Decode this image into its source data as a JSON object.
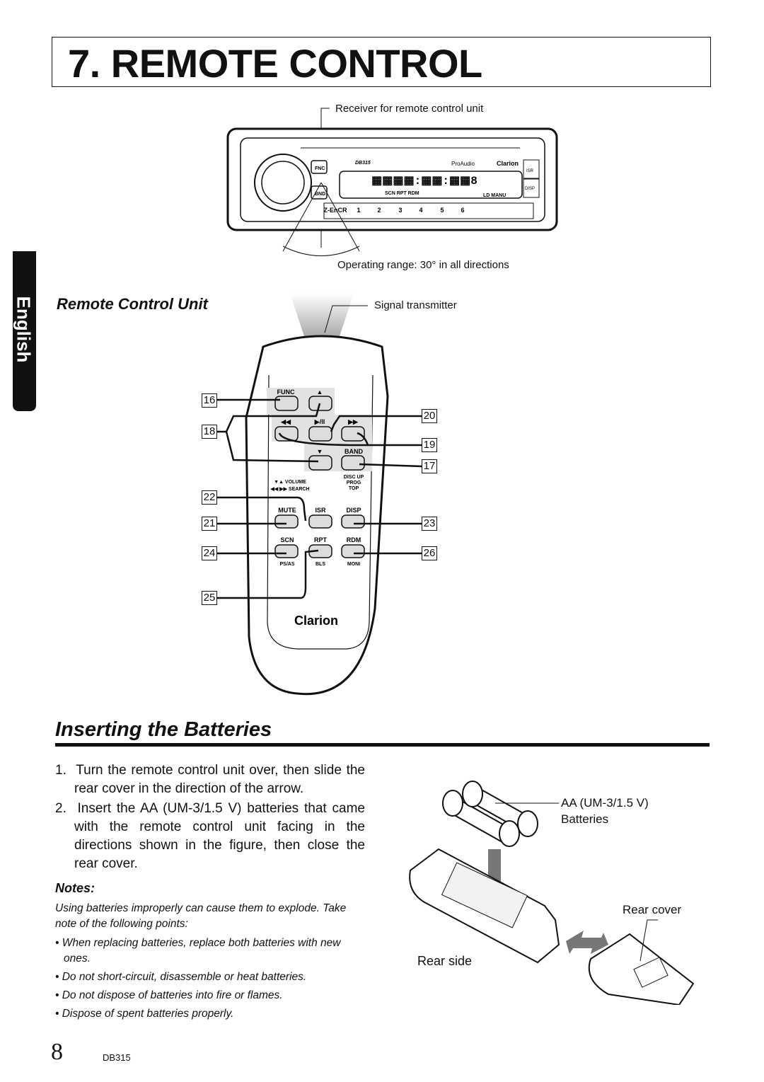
{
  "header": {
    "title": "7. REMOTE CONTROL"
  },
  "side_tab": {
    "language": "English"
  },
  "head_unit": {
    "receiver_label": "Receiver for remote control unit",
    "operating_range": "Operating range: 30° in all directions",
    "model": "DB315",
    "brand": "Clarion",
    "series": "ProAudio",
    "buttons": [
      "FNC",
      "BND",
      "ISR",
      "DISP",
      "Z-EnCR",
      "1",
      "2",
      "3",
      "4",
      "5",
      "6"
    ],
    "display_text": "SCN RPT RDM",
    "display_right": "LD MANU"
  },
  "remote": {
    "section_title": "Remote Control Unit",
    "transmitter_label": "Signal transmitter",
    "brand": "Clarion",
    "buttons": {
      "func": "FUNC",
      "band": "BAND",
      "mute": "MUTE",
      "isr": "ISR",
      "disp": "DISP",
      "scn": "SCN",
      "rpt": "RPT",
      "rdm": "RDM"
    },
    "sublabels": {
      "volume": "▼▲ VOLUME",
      "search": "◀◀ ▶▶ SEARCH",
      "band_sub": "DISC UP\nPROG\nTOP",
      "scn_sub": "PS/AS",
      "rpt_sub": "BLS",
      "rdm_sub": "MONI"
    },
    "callouts_left": [
      "16",
      "18",
      "22",
      "21",
      "24",
      "25"
    ],
    "callouts_right": [
      "20",
      "19",
      "17",
      "23",
      "26"
    ]
  },
  "batteries": {
    "section_title": "Inserting the Batteries",
    "steps": [
      "1.  Turn the remote control unit over, then slide the rear cover in the direction of the arrow.",
      "2.  Insert the AA (UM-3/1.5 V) batteries that came with the remote control unit facing in the directions shown in the figure, then close the rear cover."
    ],
    "notes_title": "Notes:",
    "notes_intro": "Using batteries improperly can cause them to explode. Take note of the following points:",
    "notes": [
      "When replacing batteries, replace both batteries with new ones.",
      "Do not short-circuit, disassemble or heat batteries.",
      "Do not dispose of batteries into fire or flames.",
      "Dispose of spent batteries properly."
    ],
    "labels": {
      "battery_type": "AA (UM-3/1.5 V)",
      "battery_word": "Batteries",
      "rear_cover": "Rear cover",
      "rear_side": "Rear side"
    }
  },
  "footer": {
    "page_number": "8",
    "model": "DB315"
  }
}
